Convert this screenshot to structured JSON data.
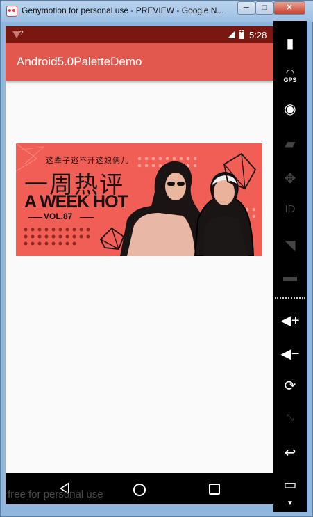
{
  "window": {
    "title": "Genymotion for personal use - PREVIEW - Google N...",
    "minimize": "─",
    "maximize": "□",
    "close": "✕"
  },
  "status_bar": {
    "time": "5:28",
    "wifi_badge": "?"
  },
  "app_bar": {
    "title": "Android5.0PaletteDemo"
  },
  "banner": {
    "subtitle": "这辈子逃不开这娘俩儿",
    "title_cn": "一周热评",
    "title_en": "A WEEK HOT",
    "volume": "VOL.87"
  },
  "watermark": "free for personal use",
  "toolbar": {
    "gps_label": "GPS",
    "icons": [
      "battery-icon",
      "gps-icon",
      "camera-icon",
      "video-icon",
      "dpad-icon",
      "id-icon",
      "rss-icon",
      "sms-icon",
      "volume-up-icon",
      "volume-down-icon",
      "rotate-icon",
      "pixel-perfect-icon",
      "back-icon",
      "recent-apps-icon"
    ]
  },
  "colors": {
    "status_bar": "#7a1710",
    "app_bar": "#e3584e",
    "banner_bg": "#f05e55"
  }
}
